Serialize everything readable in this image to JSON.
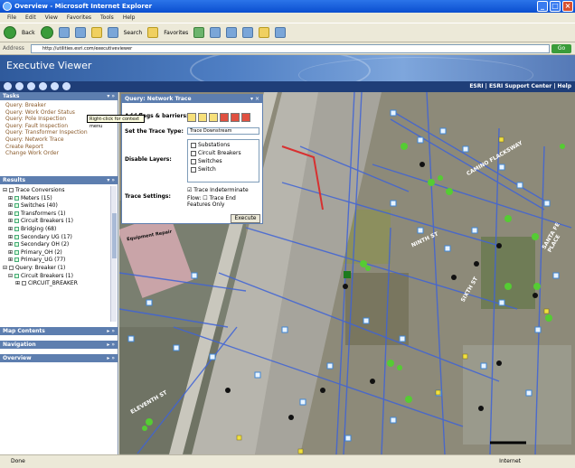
{
  "window": {
    "title": "Overview - Microsoft Internet Explorer"
  },
  "menu": [
    "File",
    "Edit",
    "View",
    "Favorites",
    "Tools",
    "Help"
  ],
  "toolbar": {
    "back": "Back",
    "search": "Search",
    "favorites": "Favorites"
  },
  "address": {
    "label": "Address",
    "value": "http://utilities.esri.com/executiveviewer",
    "go": "Go"
  },
  "app": {
    "title": "Executive Viewer",
    "links": "ESRI | ESRI Support Center | Help"
  },
  "tasks": {
    "header": "Tasks",
    "items": [
      "Query: Breaker",
      "Query: Work Order Status",
      "Query: Pole Inspection",
      "Query: Fault Inspection",
      "Query: Transformer Inspection",
      "Query: Network Trace",
      "Create Report",
      "Change Work Order"
    ]
  },
  "results": {
    "header": "Results",
    "items": [
      "Trace Conversions",
      "Meters (15)",
      "Switches (40)",
      "Transformers (1)",
      "Circuit Breakers (1)",
      "Bridging (68)",
      "Secondary UG (17)",
      "Secondary OH (2)",
      "Primary_OH (2)",
      "Primary_UG (77)",
      "Query: Breaker (1)",
      "Circuit Breakers (1)",
      "CIRCUIT_BREAKER"
    ],
    "tooltip": "Right-click for context menu"
  },
  "collapsed_panels": [
    "Map Contents",
    "Navigation",
    "Overview"
  ],
  "trace_panel": {
    "header": "Query: Network Trace",
    "add_flags_label": "Add flags & barriers:",
    "trace_type_label": "Set the Trace Type:",
    "trace_type_value": "Trace Downstream",
    "disable_layers_label": "Disable Layers:",
    "layers": [
      "Substations",
      "Circuit Breakers",
      "Switches",
      "Switch"
    ],
    "settings_label": "Trace Settings:",
    "trace_indeterminate": "Trace Indeterminate",
    "flow_label": "Flow:",
    "trace_end_features": "Trace End Features Only",
    "execute": "Execute"
  },
  "map_labels": {
    "street1": "CAMINO FLACKSWAY",
    "street2": "NINTH ST",
    "street3": "SANTA FE PLACE",
    "street4": "ELEVENTH ST",
    "street5": "SIXTH ST",
    "parcel": "Equipment Repair"
  },
  "status": {
    "left": "Done",
    "right": "Internet"
  }
}
